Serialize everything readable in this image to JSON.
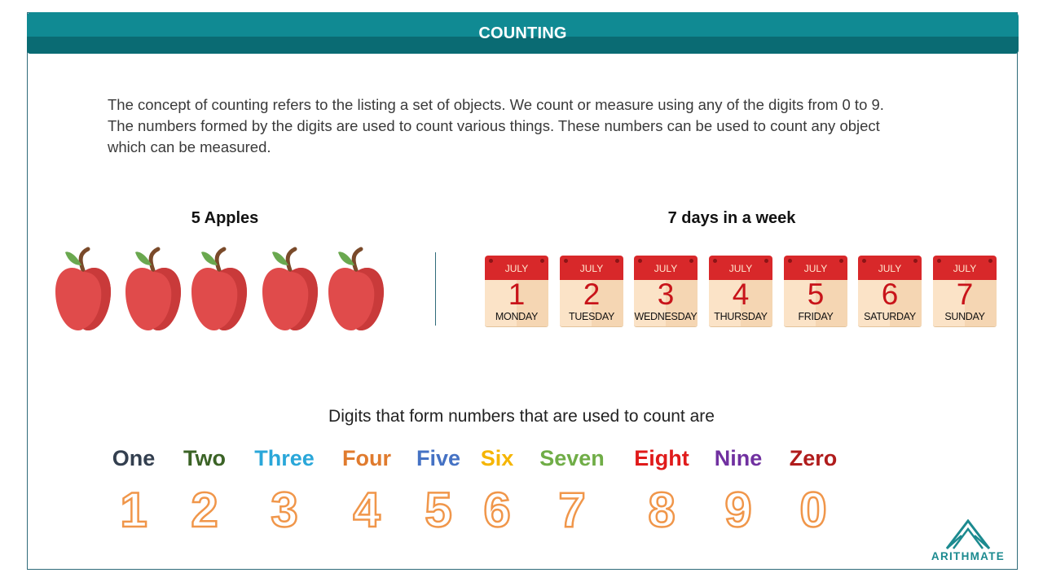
{
  "header": {
    "title": "COUNTING"
  },
  "intro": {
    "line1": "The concept of counting refers to the listing a set of objects. We count or measure using any of the digits from 0 to 9.",
    "line2": "The numbers formed by the digits are used to count various things. These numbers can be used to count any object",
    "line3": "which can be measured."
  },
  "apples": {
    "title": "5 Apples",
    "count": 5
  },
  "week": {
    "title": "7 days in a week",
    "month": "JULY",
    "days": [
      {
        "num": "1",
        "name": "MONDAY"
      },
      {
        "num": "2",
        "name": "TUESDAY"
      },
      {
        "num": "3",
        "name": "WEDNESDAY"
      },
      {
        "num": "4",
        "name": "THURSDAY"
      },
      {
        "num": "5",
        "name": "FRIDAY"
      },
      {
        "num": "6",
        "name": "SATURDAY"
      },
      {
        "num": "7",
        "name": "SUNDAY"
      }
    ]
  },
  "digits": {
    "caption": "Digits that form numbers that are used to count are",
    "items": [
      {
        "word": "One",
        "numeral": "1",
        "color": "#333f4f"
      },
      {
        "word": "Two",
        "numeral": "2",
        "color": "#3b6326"
      },
      {
        "word": "Three",
        "numeral": "3",
        "color": "#2aa7d9"
      },
      {
        "word": "Four",
        "numeral": "4",
        "color": "#e07b2e"
      },
      {
        "word": "Five",
        "numeral": "5",
        "color": "#4572c4"
      },
      {
        "word": "Six",
        "numeral": "6",
        "color": "#f5b500"
      },
      {
        "word": "Seven",
        "numeral": "7",
        "color": "#70ad47"
      },
      {
        "word": "Eight",
        "numeral": "8",
        "color": "#e01b1b"
      },
      {
        "word": "Nine",
        "numeral": "9",
        "color": "#7030a0"
      },
      {
        "word": "Zero",
        "numeral": "0",
        "color": "#b01c1c"
      }
    ]
  },
  "logo": {
    "text": "ARITHMATE"
  }
}
